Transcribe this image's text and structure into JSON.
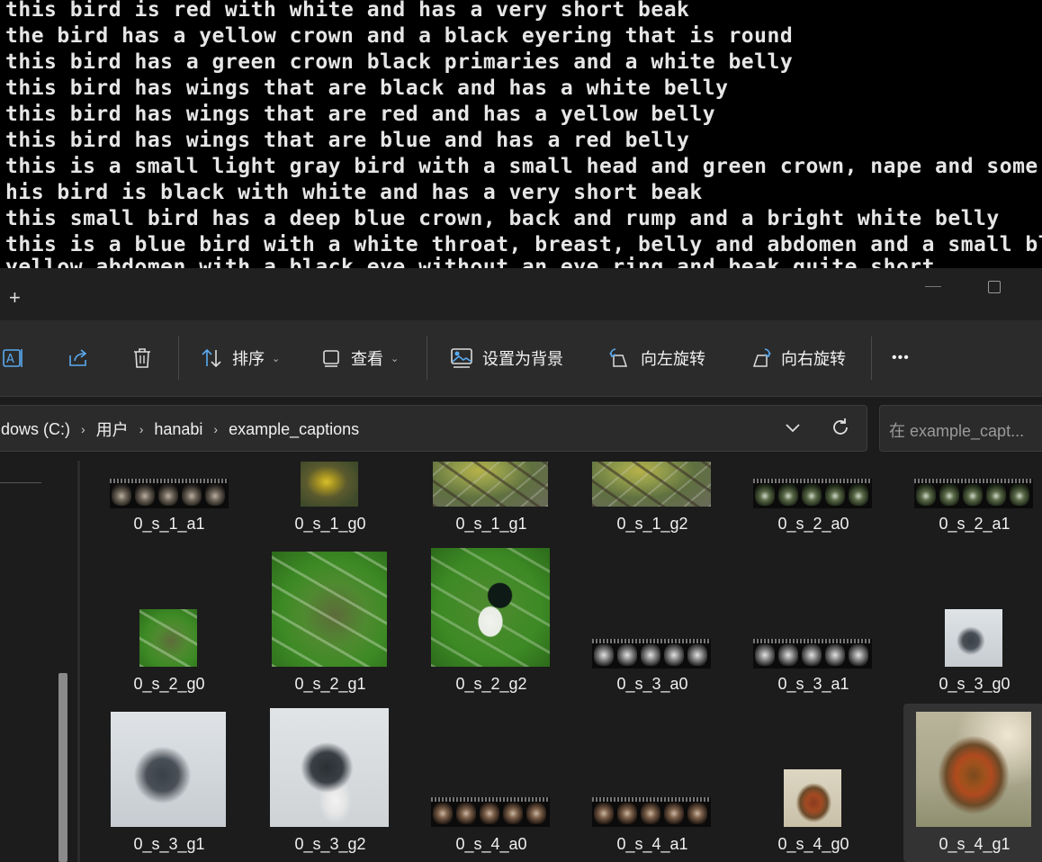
{
  "terminal": {
    "lines": [
      "this bird is red with white and has a very short beak",
      "the bird has a yellow crown and a black eyering that is round",
      "this bird has a green crown black primaries and a white belly",
      "this bird has wings that are black and has a white belly",
      "this bird has wings that are red and has a yellow belly",
      "this bird has wings that are blue and has a red belly",
      "this is a small light gray bird with a small head and green crown, nape and some gr",
      "his bird is black with white and has a very short beak",
      "this small bird has a deep blue crown, back and rump and a bright white belly",
      "this is a blue bird with a white throat, breast, belly and abdomen and a small blac",
      "yellow abdomen with a black eye without an eye ring and beak quite short"
    ]
  },
  "window": {
    "new_tab": "+"
  },
  "toolbar": {
    "sort_label": "排序",
    "view_label": "查看",
    "set_background_label": "设置为背景",
    "rotate_left_label": "向左旋转",
    "rotate_right_label": "向右旋转",
    "more_label": "•••"
  },
  "address": {
    "crumbs": [
      "dows (C:)",
      "用户",
      "hanabi",
      "example_captions"
    ],
    "separator": "›",
    "search_placeholder": "在 example_capt..."
  },
  "files": [
    {
      "name": "0_s_1_a1",
      "kind": "strip"
    },
    {
      "name": "0_s_1_g0",
      "kind": "yellow"
    },
    {
      "name": "0_s_1_g1",
      "kind": "branch"
    },
    {
      "name": "0_s_1_g2",
      "kind": "branch"
    },
    {
      "name": "0_s_2_a0",
      "kind": "strip-green"
    },
    {
      "name": "0_s_2_a1",
      "kind": "strip-green"
    },
    {
      "name": "0_s_2_g0",
      "kind": "leaf"
    },
    {
      "name": "0_s_2_g1",
      "kind": "leaf"
    },
    {
      "name": "0_s_2_g2",
      "kind": "magpie"
    },
    {
      "name": "0_s_3_a0",
      "kind": "strip-gray"
    },
    {
      "name": "0_s_3_a1",
      "kind": "strip-gray"
    },
    {
      "name": "0_s_3_g0",
      "kind": "kingfisher"
    },
    {
      "name": "0_s_3_g1",
      "kind": "kingfisher"
    },
    {
      "name": "0_s_3_g2",
      "kind": "kingfisher2"
    },
    {
      "name": "0_s_4_a0",
      "kind": "strip-brown"
    },
    {
      "name": "0_s_4_a1",
      "kind": "strip-brown"
    },
    {
      "name": "0_s_4_g0",
      "kind": "tanager"
    },
    {
      "name": "0_s_4_g1",
      "kind": "tanager-big",
      "selected": true
    }
  ]
}
